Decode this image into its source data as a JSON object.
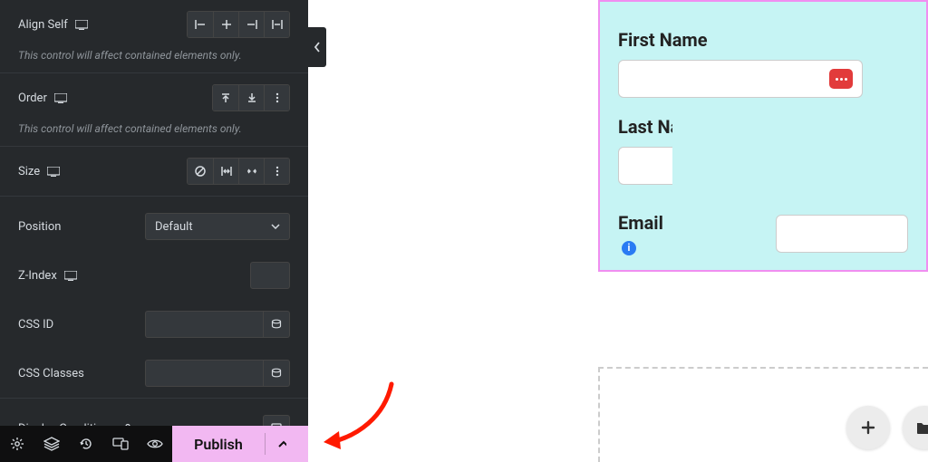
{
  "panel": {
    "align_self": {
      "label": "Align Self",
      "note": "This control will affect contained elements only."
    },
    "order": {
      "label": "Order",
      "note": "This control will affect contained elements only."
    },
    "size": {
      "label": "Size"
    },
    "position": {
      "label": "Position",
      "value": "Default"
    },
    "zindex": {
      "label": "Z-Index",
      "value": ""
    },
    "css_id": {
      "label": "CSS ID",
      "value": ""
    },
    "css_classes": {
      "label": "CSS Classes",
      "value": ""
    },
    "display_conditions": {
      "label": "Display Conditions"
    }
  },
  "bottombar": {
    "publish_label": "Publish"
  },
  "form": {
    "first_name_label": "First Name",
    "last_name_label": "Last Name",
    "email_label": "Email"
  }
}
